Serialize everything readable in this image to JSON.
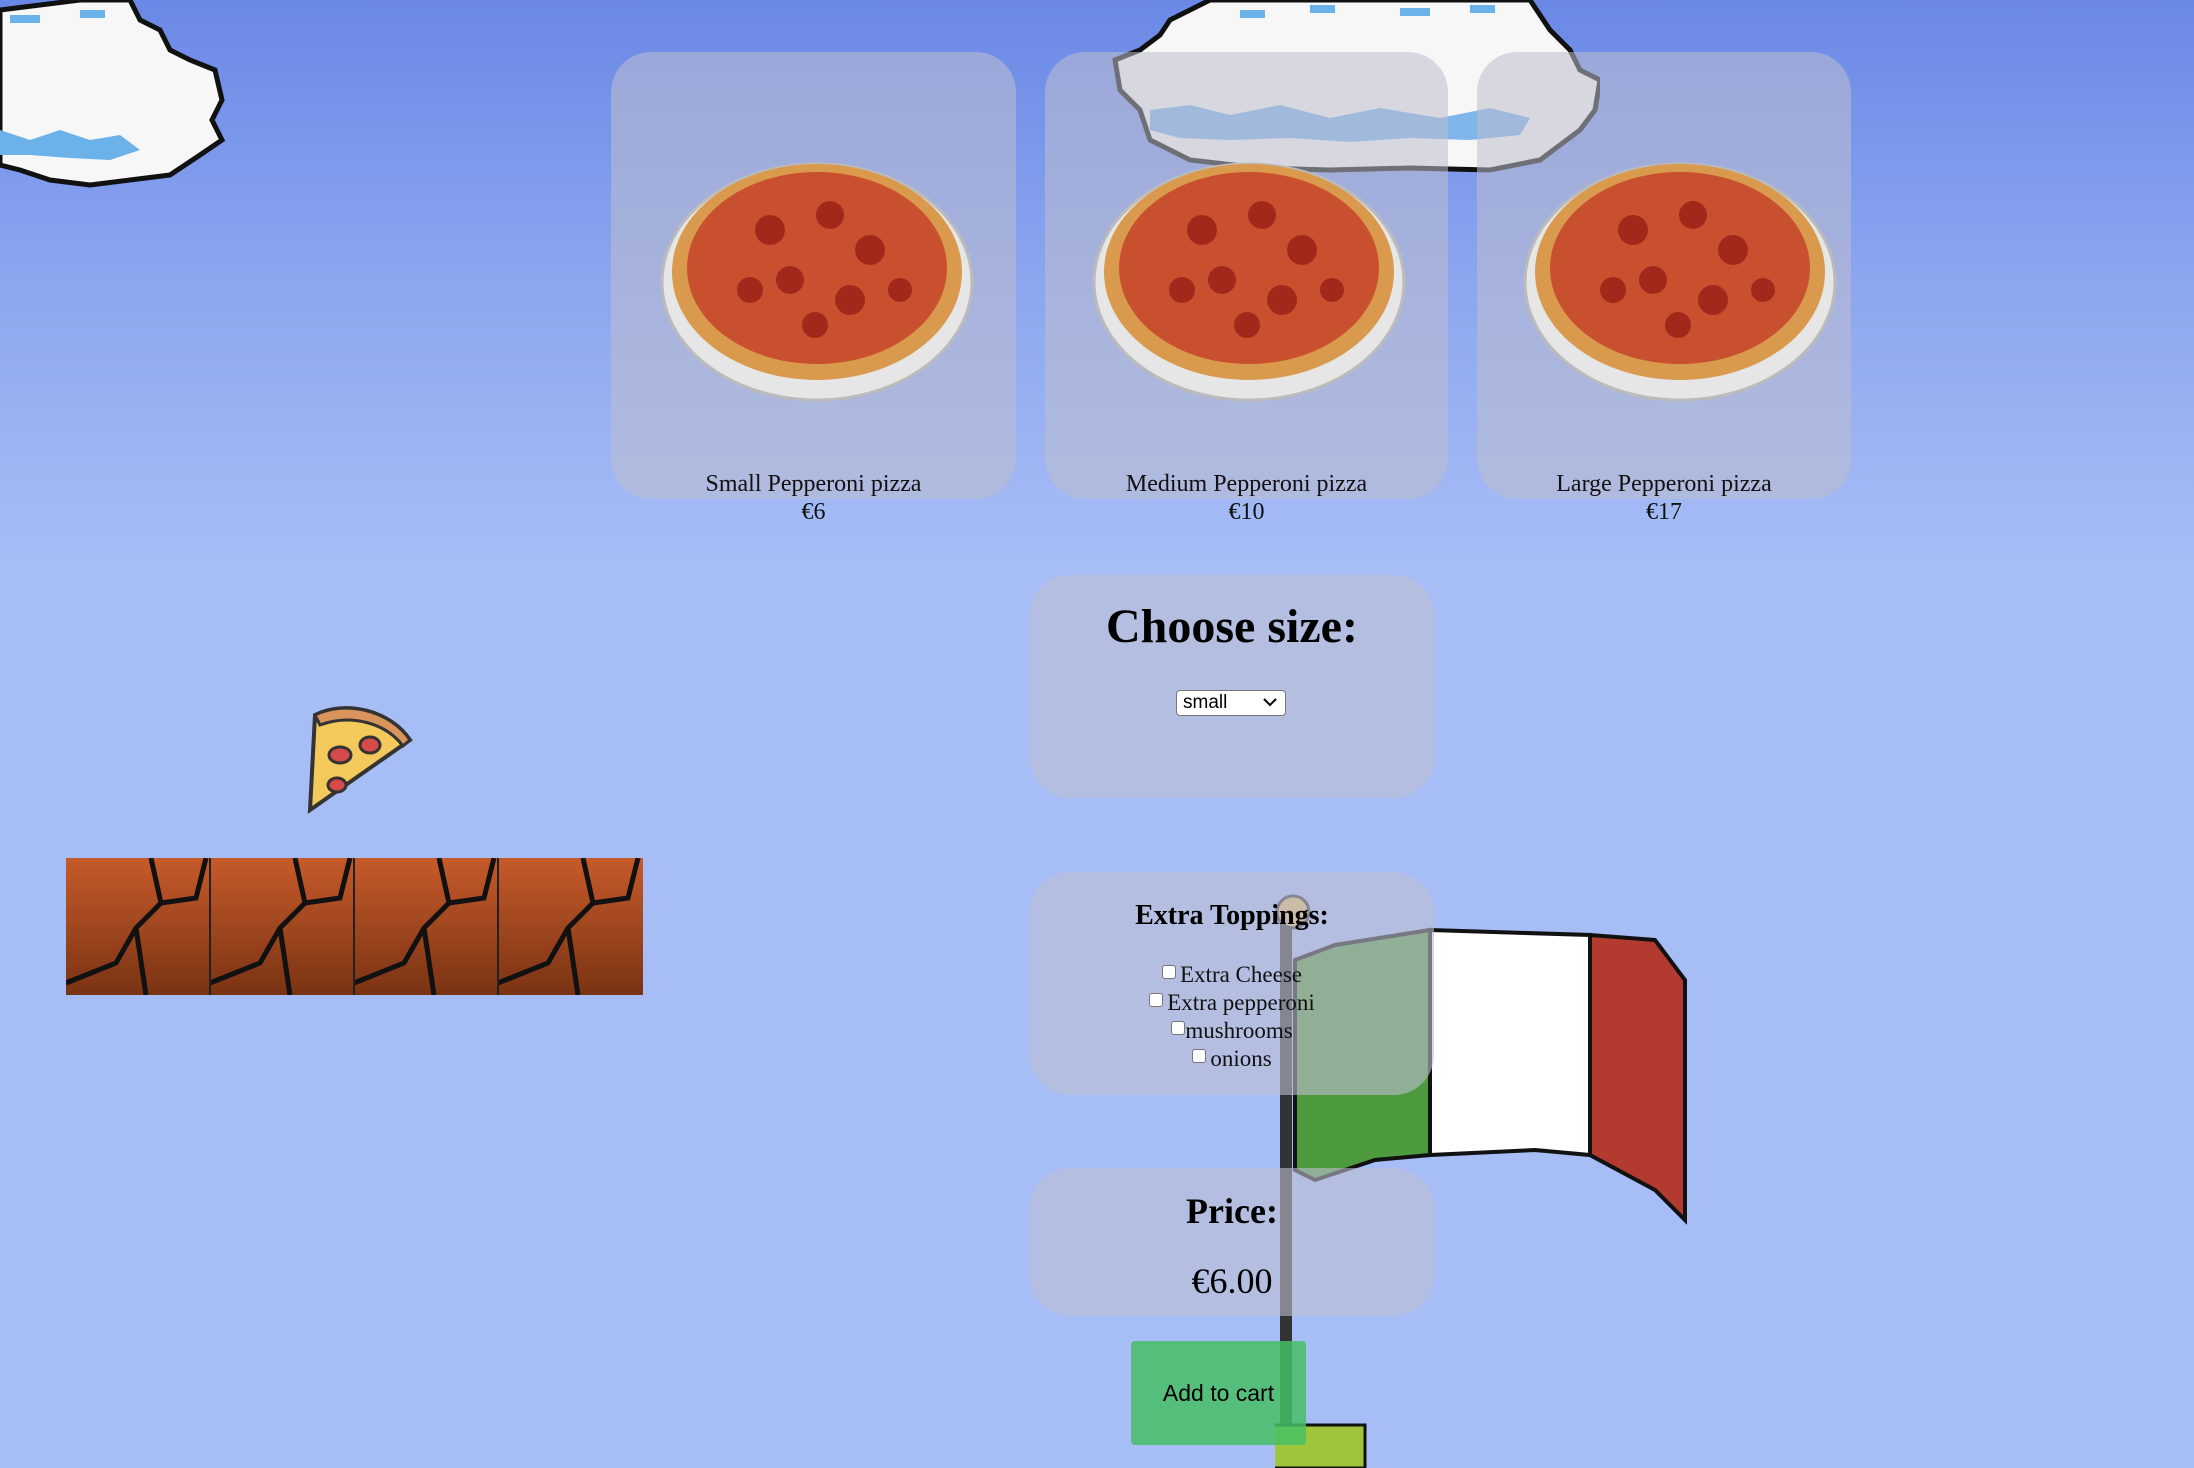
{
  "products": [
    {
      "name": "Small Pepperoni pizza",
      "price": "€6"
    },
    {
      "name": "Medium Pepperoni pizza",
      "price": "€10"
    },
    {
      "name": "Large Pepperoni pizza",
      "price": "€17"
    }
  ],
  "size_panel": {
    "title": "Choose size:",
    "selected": "small"
  },
  "toppings_panel": {
    "title": "Extra Toppings:",
    "options": [
      {
        "label": "Extra Cheese",
        "checked": false
      },
      {
        "label": "Extra pepperoni",
        "checked": false
      },
      {
        "label": "mushrooms",
        "checked": false
      },
      {
        "label": "onions",
        "checked": false
      }
    ]
  },
  "price_panel": {
    "title": "Price:",
    "value": "€6.00"
  },
  "cart": {
    "add_label": "Add to cart"
  },
  "colors": {
    "add_button": "#5cbf74",
    "sky_top": "#6a88e6",
    "sky_bottom": "#a6bdf6"
  }
}
